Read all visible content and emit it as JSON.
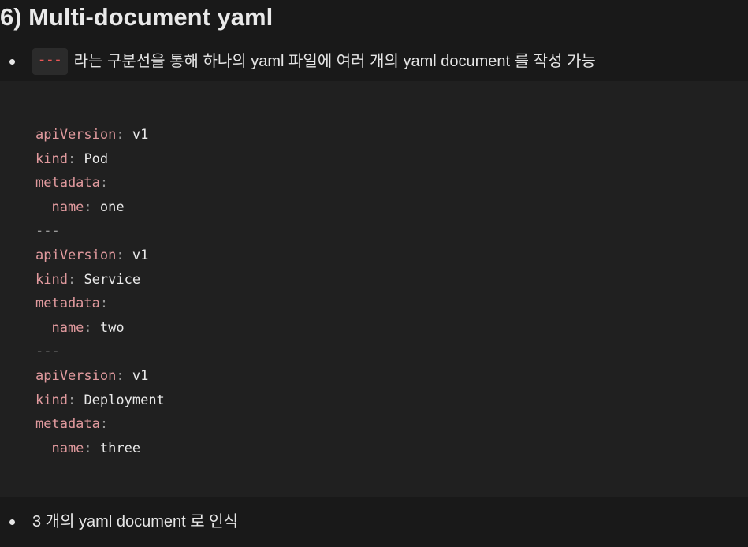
{
  "heading": "6) Multi-document yaml",
  "bullets": [
    {
      "code": "---",
      "text": "라는 구분선을 통해 하나의 yaml 파일에 여러 개의 yaml document 를 작성 가능"
    },
    {
      "text": "3 개의 yaml document 로 인식"
    }
  ],
  "code_lines": [
    {
      "key": "apiVersion",
      "value": "v1"
    },
    {
      "key": "kind",
      "value": "Pod"
    },
    {
      "key": "metadata",
      "value": ""
    },
    {
      "key": "  name",
      "value": "one"
    },
    {
      "sep": "---"
    },
    {
      "key": "apiVersion",
      "value": "v1"
    },
    {
      "key": "kind",
      "value": "Service"
    },
    {
      "key": "metadata",
      "value": ""
    },
    {
      "key": "  name",
      "value": "two"
    },
    {
      "sep": "---"
    },
    {
      "key": "apiVersion",
      "value": "v1"
    },
    {
      "key": "kind",
      "value": "Deployment"
    },
    {
      "key": "metadata",
      "value": ""
    },
    {
      "key": "  name",
      "value": "three"
    }
  ]
}
